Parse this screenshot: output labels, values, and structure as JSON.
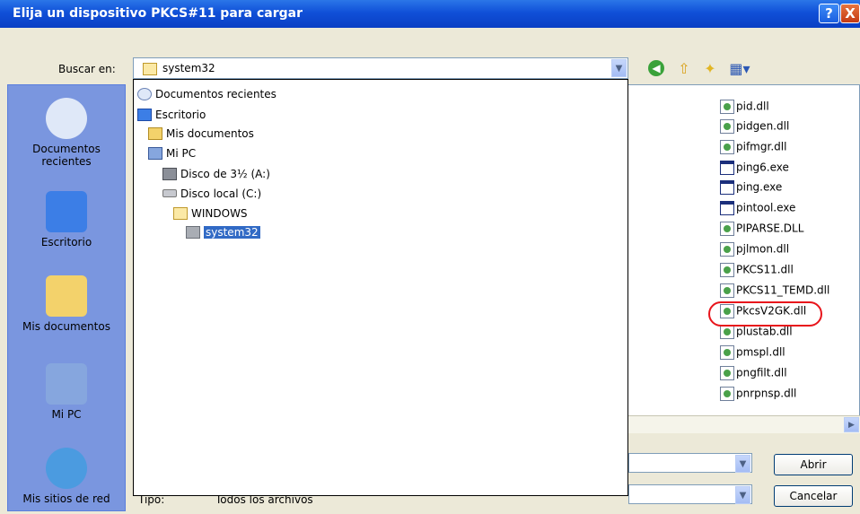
{
  "window": {
    "title": "Elija un dispositivo PKCS#11 para cargar",
    "help": "?",
    "close": "X"
  },
  "toolbar": {
    "lookin_label": "Buscar en:",
    "lookin_value": "system32",
    "icons": [
      "back-icon",
      "up-folder-icon",
      "new-folder-icon",
      "view-menu-icon"
    ]
  },
  "places": [
    {
      "label": "Documentos recientes",
      "icon": "recent-docs-icon"
    },
    {
      "label": "Escritorio",
      "icon": "desktop-icon"
    },
    {
      "label": "Mis documentos",
      "icon": "my-documents-icon"
    },
    {
      "label": "Mi PC",
      "icon": "my-computer-icon"
    },
    {
      "label": "Mis sitios de red",
      "icon": "network-places-icon"
    }
  ],
  "dropdown": [
    {
      "label": "Documentos recientes",
      "icon": "recent-icon"
    },
    {
      "label": "Escritorio",
      "icon": "desktop-icon"
    },
    {
      "label": "Mis documentos",
      "icon": "documents-folder-icon"
    },
    {
      "label": "Mi PC",
      "icon": "computer-icon"
    },
    {
      "label": "Disco de 3½ (A:)",
      "icon": "floppy-icon"
    },
    {
      "label": "Disco local (C:)",
      "icon": "drive-icon"
    },
    {
      "label": "WINDOWS",
      "icon": "open-folder-icon"
    },
    {
      "label": "system32",
      "icon": "folder-icon",
      "selected": true
    }
  ],
  "files": [
    {
      "name": "pid.dll",
      "type": "dll"
    },
    {
      "name": "pidgen.dll",
      "type": "dll"
    },
    {
      "name": "pifmgr.dll",
      "type": "dll"
    },
    {
      "name": "ping6.exe",
      "type": "exe"
    },
    {
      "name": "ping.exe",
      "type": "exe"
    },
    {
      "name": "pintool.exe",
      "type": "exe"
    },
    {
      "name": "PIPARSE.DLL",
      "type": "dll"
    },
    {
      "name": "pjlmon.dll",
      "type": "dll"
    },
    {
      "name": "PKCS11.dll",
      "type": "dll"
    },
    {
      "name": "PKCS11_TEMD.dll",
      "type": "dll"
    },
    {
      "name": "PkcsV2GK.dll",
      "type": "dll",
      "highlighted": true
    },
    {
      "name": "plustab.dll",
      "type": "dll"
    },
    {
      "name": "pmspl.dll",
      "type": "dll"
    },
    {
      "name": "pngfilt.dll",
      "type": "dll"
    },
    {
      "name": "pnrpnsp.dll",
      "type": "dll"
    }
  ],
  "filetype": {
    "label": "Tipo:",
    "value": "Todos los archivos"
  },
  "buttons": {
    "open": "Abrir",
    "cancel": "Cancelar"
  }
}
